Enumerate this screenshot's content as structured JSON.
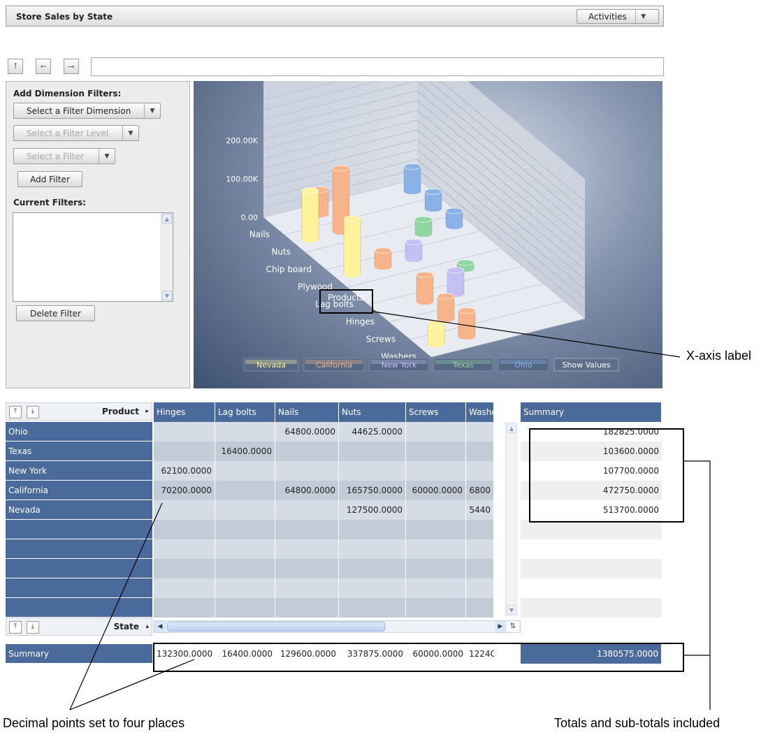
{
  "window": {
    "title": "Store Sales by State",
    "activities_label": "Activities"
  },
  "left_panel": {
    "add_filters_heading": "Add Dimension Filters:",
    "select_dimension": "Select a Filter Dimension",
    "select_level": "Select a Filter Level",
    "select_filter": "Select a Filter",
    "add_filter": "Add Filter",
    "current_filters_heading": "Current Filters:",
    "delete_filter": "Delete Filter"
  },
  "chart_data": {
    "type": "bar",
    "xlabel": "Products",
    "ytick_labels": [
      "200.00K",
      "100.00K",
      "0.00"
    ],
    "categories": [
      "Nails",
      "Nuts",
      "Chip board",
      "Plywood",
      "Lag bolts",
      "Hinges",
      "Screws",
      "Washers"
    ],
    "series": [
      {
        "name": "Nevada",
        "color": "#fff29a",
        "values": [
          0,
          127500,
          0,
          145000,
          0,
          0,
          0,
          54400
        ]
      },
      {
        "name": "California",
        "color": "#f7b48a",
        "values": [
          64800,
          165750,
          0,
          42000,
          0,
          70200,
          60000,
          68000
        ]
      },
      {
        "name": "New York",
        "color": "#c4c0f4",
        "values": [
          0,
          0,
          0,
          45000,
          0,
          62100,
          0,
          0
        ]
      },
      {
        "name": "Texas",
        "color": "#8fd6a0",
        "values": [
          0,
          0,
          38000,
          0,
          16400,
          0,
          0,
          0
        ]
      },
      {
        "name": "Ohio",
        "color": "#8ab2e6",
        "values": [
          64800,
          44625,
          40000,
          0,
          0,
          0,
          0,
          0
        ]
      }
    ],
    "legend": [
      "Nevada",
      "California",
      "New York",
      "Texas",
      "Ohio"
    ],
    "show_values_label": "Show Values"
  },
  "grid": {
    "product_label": "Product",
    "state_label": "State",
    "columns": [
      "Hinges",
      "Lag bolts",
      "Nails",
      "Nuts",
      "Screws",
      "Washe"
    ],
    "summary_header": "Summary",
    "rows": [
      {
        "state": "Ohio",
        "cells": [
          "",
          "",
          "64800.0000",
          "44625.0000",
          "",
          ""
        ],
        "summary": "182825.0000"
      },
      {
        "state": "Texas",
        "cells": [
          "",
          "16400.0000",
          "",
          "",
          "",
          ""
        ],
        "summary": "103600.0000"
      },
      {
        "state": "New York",
        "cells": [
          "62100.0000",
          "",
          "",
          "",
          "",
          ""
        ],
        "summary": "107700.0000"
      },
      {
        "state": "California",
        "cells": [
          "70200.0000",
          "",
          "64800.0000",
          "165750.0000",
          "60000.0000",
          "6800"
        ],
        "summary": "472750.0000"
      },
      {
        "state": "Nevada",
        "cells": [
          "",
          "",
          "",
          "127500.0000",
          "",
          "5440"
        ],
        "summary": "513700.0000"
      }
    ],
    "summary_row_label": "Summary",
    "summary_row": [
      "132300.0000",
      "16400.0000",
      "129600.0000",
      "337875.0000",
      "60000.0000",
      "1224C"
    ],
    "grand_total": "1380575.0000"
  },
  "annotations": {
    "x_axis_label": "X-axis label",
    "decimal_points": "Decimal points set to four places",
    "totals": "Totals and sub-totals included"
  }
}
